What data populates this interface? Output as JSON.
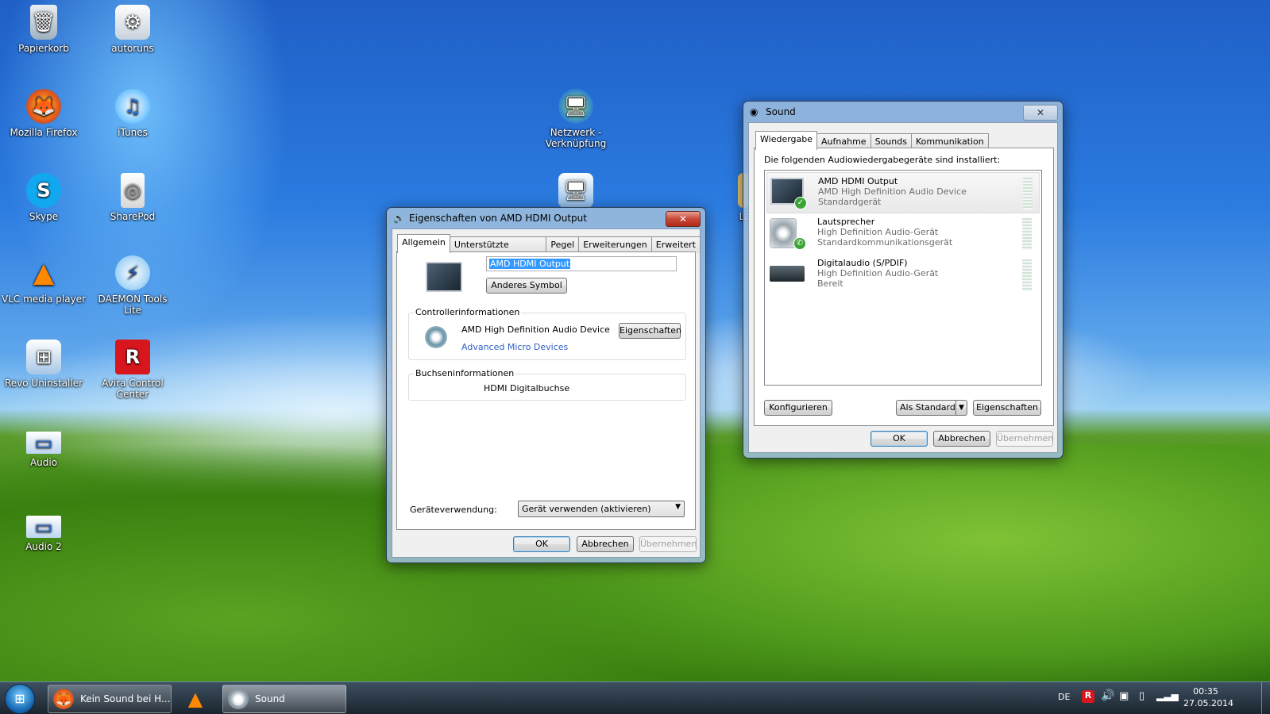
{
  "desktop_icons": [
    {
      "label": "Papierkorb",
      "icon": "recycle-bin-icon"
    },
    {
      "label": "autoruns",
      "icon": "autoruns-icon"
    },
    {
      "label": "Mozilla Firefox",
      "icon": "firefox-icon"
    },
    {
      "label": "iTunes",
      "icon": "itunes-icon"
    },
    {
      "label": "Skype",
      "icon": "skype-icon"
    },
    {
      "label": "SharePod",
      "icon": "sharepod-icon"
    },
    {
      "label": "VLC media player",
      "icon": "vlc-icon"
    },
    {
      "label": "DAEMON Tools Lite",
      "icon": "daemon-tools-icon"
    },
    {
      "label": "Revo Uninstaller",
      "icon": "revo-uninstaller-icon"
    },
    {
      "label": "Avira Control Center",
      "icon": "avira-icon"
    },
    {
      "label": "Audio",
      "icon": "audio-folder-icon"
    },
    {
      "label": "Audio 2",
      "icon": "audio2-folder-icon"
    },
    {
      "label": "Netzwerk - Verknüpfung",
      "icon": "network-icon"
    },
    {
      "label": "Lar",
      "icon": "partial-icon"
    }
  ],
  "props_window": {
    "title": "Eigenschaften von AMD HDMI Output",
    "tabs": [
      "Allgemein",
      "Unterstützte Formate",
      "Pegel",
      "Erweiterungen",
      "Erweitert"
    ],
    "name_value": "AMD HDMI Output",
    "change_icon_label": "Anderes Symbol",
    "controller_group": "Controllerinformationen",
    "controller_name": "AMD High Definition Audio Device",
    "controller_vendor": "Advanced Micro Devices",
    "controller_props_label": "Eigenschaften",
    "jack_group": "Buchseninformationen",
    "jack_value": "HDMI Digitalbuchse",
    "usage_label": "Geräteverwendung:",
    "usage_value": "Gerät verwenden (aktivieren)",
    "ok_label": "OK",
    "cancel_label": "Abbrechen",
    "apply_label": "Übernehmen"
  },
  "sound_window": {
    "title": "Sound",
    "tabs": [
      "Wiedergabe",
      "Aufnahme",
      "Sounds",
      "Kommunikation"
    ],
    "intro": "Die folgenden Audiowiedergabegeräte sind installiert:",
    "devices": [
      {
        "name": "AMD HDMI Output",
        "driver": "AMD High Definition Audio Device",
        "status": "Standardgerät"
      },
      {
        "name": "Lautsprecher",
        "driver": "High Definition Audio-Gerät",
        "status": "Standardkommunikationsgerät"
      },
      {
        "name": "Digitalaudio (S/PDIF)",
        "driver": "High Definition Audio-Gerät",
        "status": "Bereit"
      }
    ],
    "configure_label": "Konfigurieren",
    "default_label": "Als Standard",
    "properties_label": "Eigenschaften",
    "ok_label": "OK",
    "cancel_label": "Abbrechen",
    "apply_label": "Übernehmen"
  },
  "taskbar": {
    "items": [
      {
        "label": "Kein Sound bei H..."
      },
      {
        "label": ""
      },
      {
        "label": "Sound"
      }
    ],
    "language": "DE",
    "time": "00:35",
    "date": "27.05.2014"
  }
}
